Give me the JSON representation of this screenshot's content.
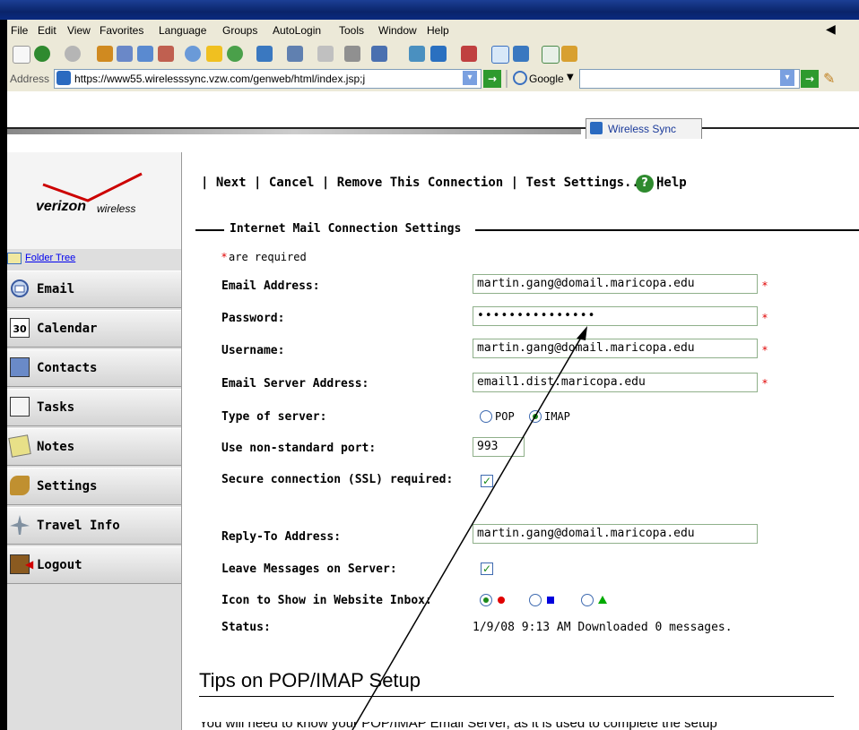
{
  "menu": [
    "File",
    "Edit",
    "View",
    "Favorites",
    "Language",
    "Groups",
    "AutoLogin",
    "Tools",
    "Window",
    "Help"
  ],
  "address": {
    "label": "Address",
    "url": "https://www55.wirelesssync.vzw.com/genweb/html/index.jsp;j",
    "search_engine": "Google"
  },
  "tab": {
    "title": "Wireless Sync"
  },
  "logo": {
    "brand": "verizon",
    "brand_suffix": "wireless"
  },
  "sidebar": {
    "folder_tree": "Folder Tree",
    "items": [
      {
        "label": "Email",
        "icon": "email-icon"
      },
      {
        "label": "Calendar",
        "icon": "calendar-icon",
        "icon_text": "30"
      },
      {
        "label": "Contacts",
        "icon": "contacts-icon"
      },
      {
        "label": "Tasks",
        "icon": "tasks-icon"
      },
      {
        "label": "Notes",
        "icon": "notes-icon"
      },
      {
        "label": "Settings",
        "icon": "settings-icon"
      },
      {
        "label": "Travel Info",
        "icon": "travel-icon"
      },
      {
        "label": "Logout",
        "icon": "logout-icon"
      }
    ]
  },
  "actions": {
    "next": "Next",
    "cancel": "Cancel",
    "remove": "Remove This Connection",
    "test": "Test Settings...",
    "help": "Help"
  },
  "section_title": "Internet Mail Connection Settings",
  "required_note": "are required",
  "form": {
    "email_label": "Email Address:",
    "email_value": "martin.gang@domail.maricopa.edu",
    "password_label": "Password:",
    "password_value": "•••••••••••••••",
    "username_label": "Username:",
    "username_value": "martin.gang@domail.maricopa.edu",
    "server_label": "Email Server Address:",
    "server_value": "email1.dist.maricopa.edu",
    "type_label": "Type of server:",
    "type_options": [
      "POP",
      "IMAP"
    ],
    "type_selected": "IMAP",
    "port_label": "Use non-standard port:",
    "port_value": "993",
    "ssl_label": "Secure connection (SSL) required:",
    "ssl_checked": true,
    "reply_label": "Reply-To Address:",
    "reply_value": "martin.gang@domail.maricopa.edu",
    "leave_label": "Leave Messages on Server:",
    "leave_checked": true,
    "icon_label": "Icon to Show in Website Inbox:",
    "icon_options": [
      {
        "shape": "circle",
        "color": "#e00000",
        "selected": true
      },
      {
        "shape": "square",
        "color": "#0000dd",
        "selected": false
      },
      {
        "shape": "triangle",
        "color": "#00aa00",
        "selected": false
      }
    ],
    "status_label": "Status:",
    "status_value": "1/9/08 9:13 AM Downloaded 0 messages."
  },
  "tips": {
    "heading": "Tips on POP/IMAP Setup",
    "body": "You will need to know your POP/IMAP Email Server, as it is used to complete the setup"
  },
  "colors": {
    "menu_bg": "#ece9d8",
    "sidebar_bg": "#dedede",
    "required": "#e00000",
    "input_border": "#8fb08a",
    "title_bar": "#0a246a"
  }
}
